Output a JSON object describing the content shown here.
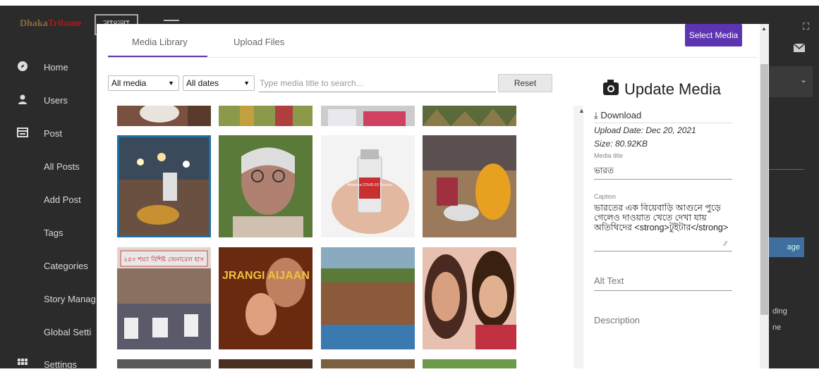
{
  "header": {
    "brand": {
      "part1": "Dhaka",
      "part2": "Tribune"
    },
    "language_button": "বাংলা",
    "menu_icon": "hamburger-icon",
    "fullscreen_icon": "expand-icon"
  },
  "sidebar": {
    "items": [
      {
        "label": "Home",
        "icon": "compass-icon"
      },
      {
        "label": "Users",
        "icon": "user-icon"
      },
      {
        "label": "Post",
        "icon": "post-icon"
      },
      {
        "label": "All Posts",
        "icon": ""
      },
      {
        "label": "Add Post",
        "icon": ""
      },
      {
        "label": "Tags",
        "icon": ""
      },
      {
        "label": "Categories",
        "icon": ""
      },
      {
        "label": "Story Manag",
        "icon": ""
      },
      {
        "label": "Global Setti",
        "icon": ""
      },
      {
        "label": "Settings",
        "icon": "grid-icon"
      }
    ]
  },
  "right_panel": {
    "button_text": "age",
    "text1": "ding",
    "text2": "ne"
  },
  "modal": {
    "tabs": [
      {
        "label": "Media Library",
        "active": true
      },
      {
        "label": "Upload Files",
        "active": false
      }
    ],
    "select_button": "Select Media",
    "filters": {
      "media_type": "All media",
      "dates": "All dates",
      "search_placeholder": "Type media title to search...",
      "reset_label": "Reset"
    },
    "grid": {
      "selected_index": 4,
      "thumbnails": [
        {
          "name": "thumb-partial-1"
        },
        {
          "name": "thumb-partial-2"
        },
        {
          "name": "thumb-partial-3"
        },
        {
          "name": "thumb-partial-4"
        },
        {
          "name": "thumb-street-food"
        },
        {
          "name": "thumb-elderly-woman"
        },
        {
          "name": "thumb-vaccine-vial"
        },
        {
          "name": "thumb-woman-cooking"
        },
        {
          "name": "thumb-hospital-protest"
        },
        {
          "name": "thumb-movie-poster"
        },
        {
          "name": "thumb-field-drying"
        },
        {
          "name": "thumb-actresses"
        }
      ],
      "vaccine_label": "Moderna COVID-19 Vaccine",
      "poster_text": "JRANGI AIJAAN",
      "sign_text": "২৫০ শয্যা বিশিষ্ট জেনারেল হাস"
    },
    "details": {
      "title": "Update Media",
      "download_label": "Download",
      "upload_date": "Upload Date:  Dec 20, 2021",
      "size": "Size:  80.92KB",
      "media_title_label": "Media title",
      "media_title_value": "ভারত",
      "caption_label": "Caption",
      "caption_value": "ভারতের এক বিয়েবাড়ি আগুনে পুড়ে গেলেও দাওয়াত খেতে দেখা যায় অতিথিদের <strong>টুইটার</strong>",
      "alt_text_placeholder": "Alt Text",
      "description_placeholder": "Description"
    }
  }
}
